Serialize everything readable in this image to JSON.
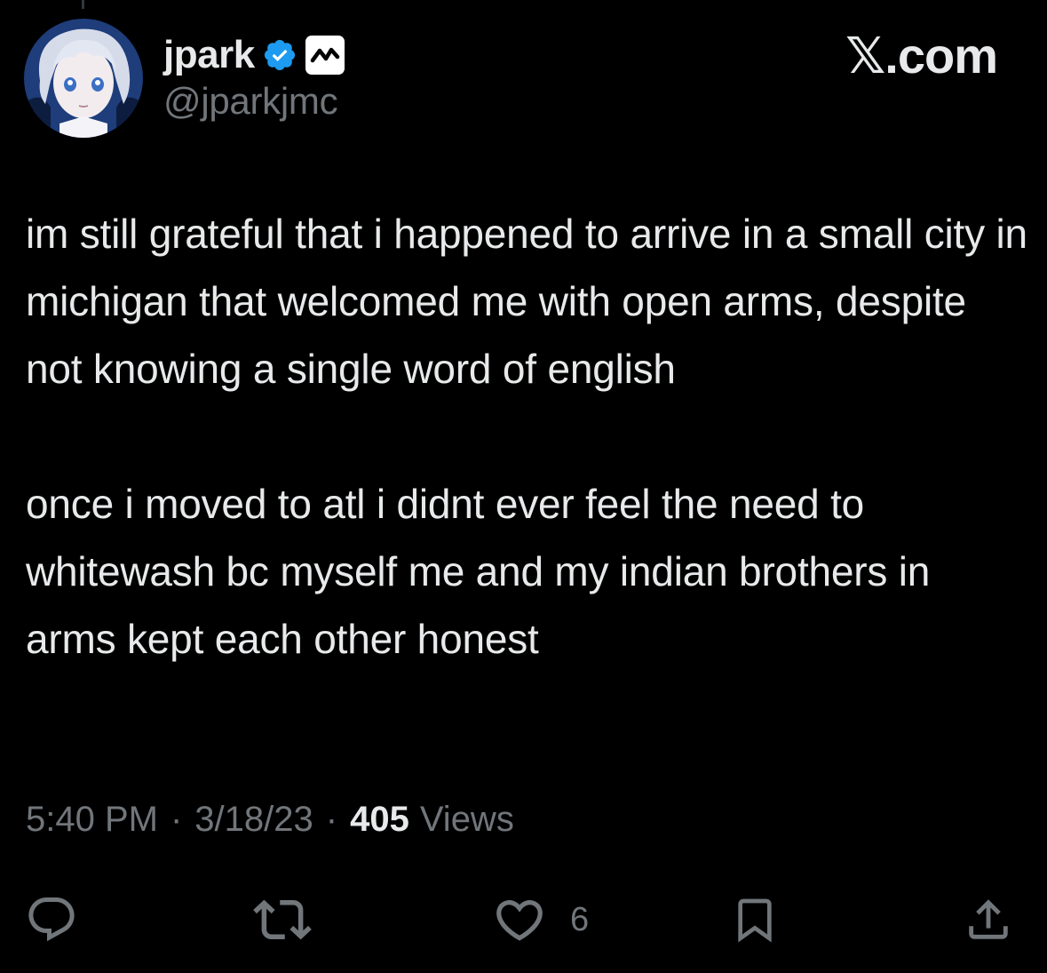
{
  "author": {
    "display_name": "jpark",
    "handle": "@jparkjmc",
    "avatar_icon": "anime-avatar",
    "verified_icon": "verified-badge-icon",
    "affiliate_icon": "affiliate-chart-icon"
  },
  "watermark": "𝕏.com",
  "tweet": {
    "paragraphs": [
      "im still grateful that i happened to arrive in a small city in michigan that welcomed me with open arms, despite not knowing a single word of english",
      "once i moved to atl i didnt ever feel the need to whitewash bc myself me and my indian brothers in arms kept each other honest"
    ]
  },
  "meta": {
    "time": "5:40 PM",
    "date": "3/18/23",
    "separator": "·",
    "views_count": "405",
    "views_label": "Views"
  },
  "actions": {
    "reply_icon": "reply-icon",
    "retweet_icon": "retweet-icon",
    "like_icon": "heart-icon",
    "like_count": "6",
    "bookmark_icon": "bookmark-icon",
    "share_icon": "share-icon"
  },
  "colors": {
    "background": "#000000",
    "text_primary": "#e7e9ea",
    "text_secondary": "#71767b",
    "verified_blue": "#1d9bf0"
  }
}
